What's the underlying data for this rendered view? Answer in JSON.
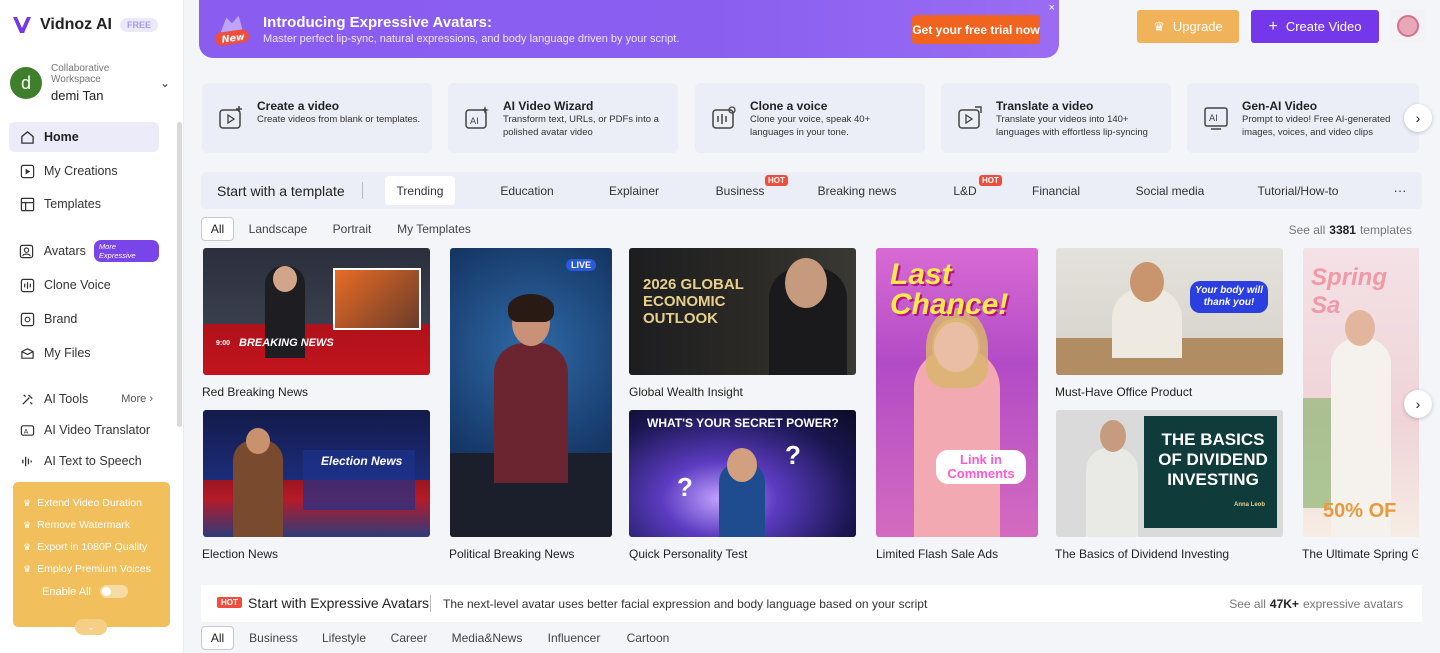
{
  "app": {
    "logo_text": "Vidnoz AI",
    "free_badge": "FREE"
  },
  "workspace": {
    "label": "Collaborative Workspace",
    "user": "demi Tan",
    "avatar_letter": "d"
  },
  "sidebar": {
    "items": [
      {
        "label": "Home",
        "icon": "home-icon"
      },
      {
        "label": "My Creations",
        "icon": "play-square-icon"
      },
      {
        "label": "Templates",
        "icon": "templates-icon"
      },
      {
        "label": "Avatars",
        "icon": "avatar-icon",
        "badge": "More Expressive"
      },
      {
        "label": "Clone Voice",
        "icon": "voice-icon"
      },
      {
        "label": "Brand",
        "icon": "brand-icon"
      },
      {
        "label": "My Files",
        "icon": "folder-icon"
      },
      {
        "label": "AI Tools",
        "icon": "tools-icon",
        "more": "More"
      },
      {
        "label": "AI Video Translator",
        "icon": "translate-icon"
      },
      {
        "label": "AI Text to Speech",
        "icon": "tts-icon"
      }
    ],
    "promo": {
      "items": [
        "Extend Video Duration",
        "Remove Watermark",
        "Export in 1080P Quality",
        "Employ Premium Voices"
      ],
      "enable_all": "Enable All"
    }
  },
  "banner": {
    "badge": "New",
    "title": "Introducing Expressive Avatars:",
    "subtitle": "Master perfect lip-sync, natural expressions, and body language driven by your script.",
    "cta": "Get your free trial now",
    "close": "×"
  },
  "header": {
    "upgrade": "Upgrade",
    "create_video": "Create Video"
  },
  "features": [
    {
      "title": "Create a video",
      "desc": "Create videos from blank or templates."
    },
    {
      "title": "AI Video Wizard",
      "desc": "Transform text, URLs, or PDFs into a polished avatar video"
    },
    {
      "title": "Clone a voice",
      "desc": "Clone your voice, speak 40+ languages in your tone."
    },
    {
      "title": "Translate a video",
      "desc": "Translate your videos into 140+ languages with effortless lip-syncing"
    },
    {
      "title": "Gen-AI Video",
      "desc": "Prompt to video! Free AI-generated images, voices, and video clips"
    }
  ],
  "templates": {
    "heading": "Start with a template",
    "categories": [
      "Trending",
      "Education",
      "Explainer",
      "Business",
      "Breaking news",
      "L&D",
      "Financial",
      "Social media",
      "Tutorial/How-to"
    ],
    "hot_label": "HOT",
    "more": "···",
    "subtabs": [
      "All",
      "Landscape",
      "Portrait",
      "My Templates"
    ],
    "see_all": "See all",
    "count": "3381",
    "count_unit": "templates",
    "cards": [
      {
        "title": "Red Breaking News",
        "thumb_text": "BREAKING NEWS",
        "ticker": "9:00"
      },
      {
        "title": "Election News",
        "thumb_text": "Election News"
      },
      {
        "title": "Political Breaking News",
        "thumb_text": "LIVE"
      },
      {
        "title": "Global Wealth Insight",
        "thumb_text": "2026 GLOBAL ECONOMIC OUTLOOK"
      },
      {
        "title": "Quick Personality Test",
        "thumb_text": "WHAT'S YOUR SECRET POWER?"
      },
      {
        "title": "Limited Flash Sale Ads",
        "thumb_text": "Last Chance!",
        "thumb_text2": "Link in Comments"
      },
      {
        "title": "Must-Have Office Product",
        "thumb_text": "Your body will thank you!"
      },
      {
        "title": "The Basics of Dividend Investing",
        "thumb_text": "THE BASICS OF DIVIDEND INVESTING",
        "presenter": "Anna Leob"
      },
      {
        "title": "The Ultimate Spring Glo",
        "thumb_text": "Spring Sa",
        "thumb_text2": "50% OF"
      }
    ]
  },
  "avatars": {
    "hot": "HOT",
    "heading": "Start with Expressive Avatars",
    "desc": "The next-level avatar uses better facial expression and body language based on your script",
    "see_all": "See all",
    "count": "47K+",
    "count_unit": "expressive avatars",
    "tabs": [
      "All",
      "Business",
      "Lifestyle",
      "Career",
      "Media&News",
      "Influencer",
      "Cartoon"
    ]
  },
  "colors": {
    "accent": "#7438ea",
    "upgrade": "#f1b35a",
    "hot": "#ef4e3c",
    "promo": "#f1bf5b"
  }
}
